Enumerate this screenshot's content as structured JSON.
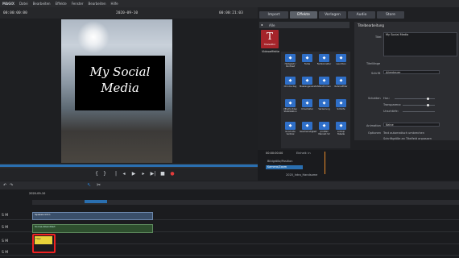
{
  "app": {
    "logo": "MAGIX"
  },
  "menu": [
    "Datei",
    "Bearbeiten",
    "Effekte",
    "Fenster",
    "Bearbeiten",
    "Hilfe"
  ],
  "preview": {
    "time_left": "00:00:00:00",
    "date": "2020-09-10",
    "time_right": "00:00:21:03",
    "title_text_line1": "My Social",
    "title_text_line2": "Media"
  },
  "tabs": [
    {
      "label": "Import"
    },
    {
      "label": "Effekte"
    },
    {
      "label": "Vorlagen"
    },
    {
      "label": "Audio"
    },
    {
      "label": "Store"
    }
  ],
  "sidebar": {
    "all_label": "Alle",
    "active_category": "Titeleditor",
    "section": "Videoeffekte"
  },
  "effects": [
    {
      "label": "Helligkeit / Kontrast",
      "icon": "brightness-icon"
    },
    {
      "label": "Farbe",
      "icon": "color-icon"
    },
    {
      "label": "Farbkorrektur",
      "icon": "color-correction-icon"
    },
    {
      "label": "Leuchten",
      "icon": "glow-icon"
    },
    {
      "label": "Chroma Key",
      "icon": "chroma-key-icon"
    },
    {
      "label": "Maskengenerator",
      "icon": "mask-icon"
    },
    {
      "label": "Stanzformen",
      "icon": "shapes-icon"
    },
    {
      "label": "Rahmeffilter",
      "icon": "frame-filter-icon"
    },
    {
      "label": "VEGAS Video Stabilization",
      "icon": "stabilization-icon"
    },
    {
      "label": "Umschalter",
      "icon": "switch-icon"
    },
    {
      "label": "Verzerrung",
      "icon": "distortion-icon"
    },
    {
      "label": "Schärfe",
      "icon": "sharpness-icon"
    },
    {
      "label": "Good-Lite Vertical",
      "icon": "vertical-icon"
    },
    {
      "label": "Geschwindigkeit",
      "icon": "speed-icon"
    },
    {
      "label": "proDAD Mercalli V2",
      "icon": "mercalli-icon"
    },
    {
      "label": "Lookup Tabelle",
      "icon": "lut-icon"
    }
  ],
  "props": {
    "header": "Titelbearbeitung",
    "title_label": "Titel",
    "title_value": "My Social  Media",
    "textlength_label": "Titellänge",
    "font_label": "Schrift",
    "font_value": "Abenteuer",
    "shadow_label": "Schatten",
    "horiz_label": "Hor.:",
    "transp_label": "Transparenz:",
    "blur_label": "Unschärfe:",
    "animation_label": "Animation",
    "animation_value": "Keine",
    "options_label": "Optionen",
    "option1": "Text automatisch umbrechen",
    "option2": "Schriftgröße an Titelfeld anpassen"
  },
  "keyframes": {
    "time": "00:00:00:00",
    "label": "Einheit: in",
    "row1": "Bildgröße/Position",
    "row2": "Kamera/Zoom",
    "clip_name": "2020_Intro_Handsome"
  },
  "timeline": {
    "date": "2020-09-10",
    "tracks": [
      {
        "label": "S M"
      },
      {
        "label": "S M"
      },
      {
        "label": "S M"
      },
      {
        "label": "S M"
      }
    ],
    "clip_video_name": "Spieleis Intro",
    "clip_audio_name": "Sonne-Abendlied",
    "clip_title_name": "Titel"
  },
  "colors": {
    "accent": "#2a6fb0",
    "highlight": "#e22222",
    "title_clip": "#e8d23a",
    "title_cat": "#a5242a"
  }
}
